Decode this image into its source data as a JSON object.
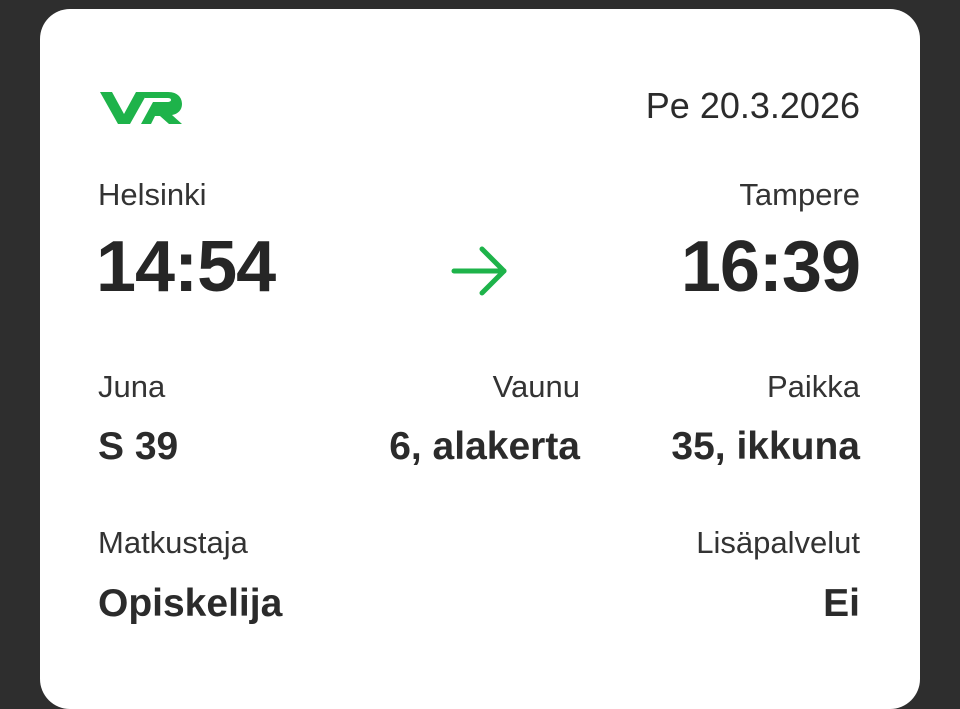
{
  "ticket": {
    "logo_text": "VR",
    "date": "Pe 20.3.2026",
    "brand_color": "#1eb34a",
    "route": {
      "from_city": "Helsinki",
      "to_city": "Tampere",
      "departure_time": "14:54",
      "arrival_time": "16:39",
      "arrow_icon": "arrow-right-icon"
    },
    "details": {
      "train_label": "Juna",
      "train_value": "S 39",
      "car_label": "Vaunu",
      "car_value": "6, alakerta",
      "seat_label": "Paikka",
      "seat_value": "35, ikkuna"
    },
    "passenger": {
      "label": "Matkustaja",
      "value": "Opiskelija"
    },
    "extras": {
      "label": "Lisäpalvelut",
      "value": "Ei"
    }
  }
}
